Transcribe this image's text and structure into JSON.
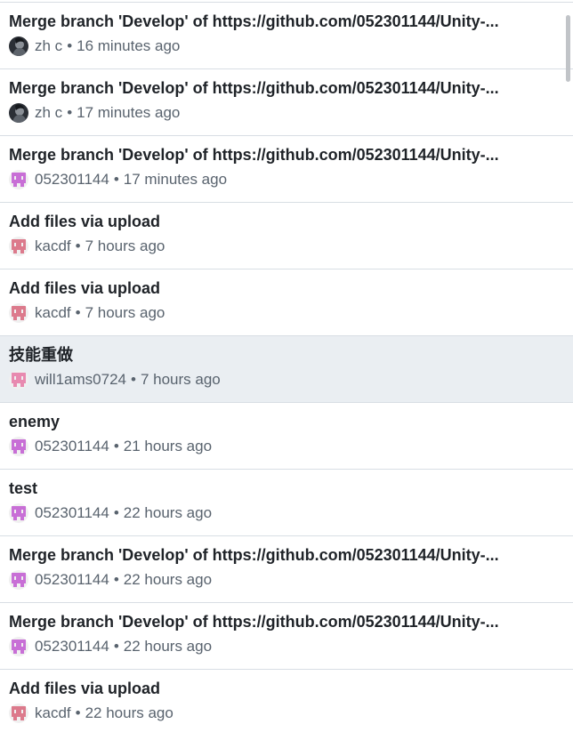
{
  "commits": [
    {
      "message": "Merge branch 'Develop' of https://github.com/052301144/Unity-...",
      "author": "zh c",
      "time": "16 minutes ago",
      "avatar": "photo-avatar-icon"
    },
    {
      "message": "Merge branch 'Develop' of https://github.com/052301144/Unity-...",
      "author": "zh c",
      "time": "17 minutes ago",
      "avatar": "photo-avatar-icon"
    },
    {
      "message": "Merge branch 'Develop' of https://github.com/052301144/Unity-...",
      "author": "052301144",
      "time": "17 minutes ago",
      "avatar": "identicon-purple-icon"
    },
    {
      "message": "Add files via upload",
      "author": "kacdf",
      "time": "7 hours ago",
      "avatar": "identicon-red-icon"
    },
    {
      "message": "Add files via upload",
      "author": "kacdf",
      "time": "7 hours ago",
      "avatar": "identicon-red-icon"
    },
    {
      "message": "技能重做",
      "author": "will1ams0724",
      "time": "7 hours ago",
      "avatar": "identicon-pink-icon",
      "highlighted": true
    },
    {
      "message": "enemy",
      "author": "052301144",
      "time": "21 hours ago",
      "avatar": "identicon-purple-icon"
    },
    {
      "message": "test",
      "author": "052301144",
      "time": "22 hours ago",
      "avatar": "identicon-purple-icon"
    },
    {
      "message": "Merge branch 'Develop' of https://github.com/052301144/Unity-...",
      "author": "052301144",
      "time": "22 hours ago",
      "avatar": "identicon-purple-icon"
    },
    {
      "message": "Merge branch 'Develop' of https://github.com/052301144/Unity-...",
      "author": "052301144",
      "time": "22 hours ago",
      "avatar": "identicon-purple-icon"
    },
    {
      "message": "Add files via upload",
      "author": "kacdf",
      "time": "22 hours ago",
      "avatar": "identicon-red-icon"
    }
  ],
  "separator": "•",
  "colors": {
    "border": "#d8dee4",
    "highlight": "#eaeef2",
    "title": "#1f2328",
    "meta": "#59636e",
    "identicon_purple": "#c86fd6",
    "identicon_red": "#dc7a8c",
    "identicon_pink": "#e88ab0"
  }
}
